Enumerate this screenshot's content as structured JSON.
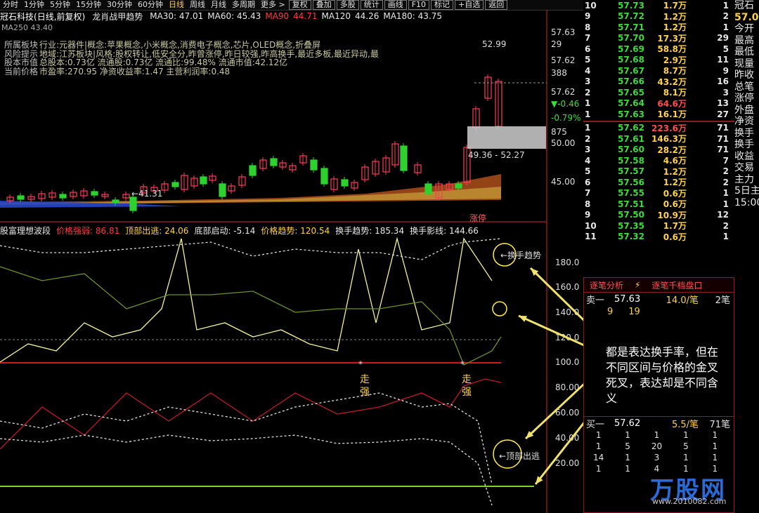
{
  "toolbar": {
    "items": [
      "分时",
      "1分钟",
      "5分钟",
      "15分钟",
      "30分钟",
      "60分钟",
      "日线",
      "周线",
      "月线",
      "多周期",
      "更多 >",
      "复权",
      "叠加",
      "多股",
      "统计",
      "画线",
      "F10",
      "标记",
      "+自选",
      "返回"
    ],
    "active": "日线"
  },
  "main_chart": {
    "stock_name": "冠石科技",
    "period_label": "(日线,前复权)",
    "indicator_name": "龙肖战甲趋势",
    "ma": [
      {
        "label": "MA30: 47.01",
        "color": "#e8e8e8"
      },
      {
        "label": "MA60: 45.43",
        "color": "#e8e8e8"
      },
      {
        "label": "MA90",
        "color": "#ff3b3b"
      },
      {
        "label": "44.71",
        "color": "#ff3b3b"
      },
      {
        "label": "MA120",
        "color": "#e8e8e8"
      },
      {
        "label": "44.26",
        "color": "#e8e8e8"
      },
      {
        "label": "MA180: 43.75",
        "color": "#e8e8e8"
      }
    ],
    "ma250": "MA250  43.40",
    "f10": [
      {
        "label": "所属板块",
        "text": "行业:元器件|概念:苹果概念,小米概念,消费电子概念,芯片,OLED概念,折叠屏"
      },
      {
        "label": "风险提示",
        "text": "地域:江苏板块|风格:股权转让,低安全分,昨曾涨停,昨日较强,昨高换手,最近多板,最近异动,最"
      },
      {
        "label": "股本市值",
        "text": "总股本:0.73亿 流通股:0.73亿 流通比:99.48% 流通市值:42.12亿"
      },
      {
        "label": "当前价格",
        "text": "市盈率:270.95 净资收益率:1.47 主营利润率:0.48"
      }
    ],
    "annotations": {
      "high": "52.99",
      "low": "←41.31",
      "range": "49.36 - 52.27",
      "zhangting": "涨停"
    },
    "y_axis": [
      {
        "v": "57.63",
        "c": "w"
      },
      {
        "v": "29",
        "c": "w"
      },
      {
        "v": "57.62",
        "c": "w"
      },
      {
        "v": "388",
        "c": "w"
      },
      {
        "v": "57.62",
        "c": "w"
      },
      {
        "v": "▼-0.46",
        "c": "g"
      },
      {
        "v": "-0.79%",
        "c": "g"
      },
      {
        "v": "875",
        "c": "w"
      },
      {
        "v": "50.00",
        "c": "w"
      },
      {
        "v": "45.00",
        "c": "w"
      }
    ]
  },
  "indicator": {
    "name": "股富理想波段",
    "items": [
      {
        "label": "价格强弱: 86.81",
        "color": "#ff3b3b"
      },
      {
        "label": "顶部出逃: 24.06",
        "color": "#ffd24a"
      },
      {
        "label": "底部启动: -5.14",
        "color": "#e8e8e8"
      },
      {
        "label": "价格趋势: 120.54",
        "color": "#ffd24a"
      },
      {
        "label": "换手趋势: 185.34",
        "color": "#e8e8e8"
      },
      {
        "label": "换手影线: 144.66",
        "color": "#e8e8e8"
      }
    ],
    "y_axis": [
      "180.0",
      "160.0",
      "140.0",
      "120.0",
      "100.0",
      "80.00",
      "60.00",
      "40.00",
      "20.00"
    ],
    "labels": {
      "zouqiang": "走强",
      "huanshou": "←换手趋势",
      "dingbu": "←顶部出逃"
    }
  },
  "order_book": {
    "sell": [
      {
        "lv": "10",
        "pr": "57.73",
        "vol": "1.7万",
        "ct": "1"
      },
      {
        "lv": "9",
        "pr": "57.72",
        "vol": "1.2万",
        "ct": "2"
      },
      {
        "lv": "8",
        "pr": "57.71",
        "vol": "1.2万",
        "ct": "1"
      },
      {
        "lv": "7",
        "pr": "57.70",
        "vol": "17.3万",
        "ct": "29"
      },
      {
        "lv": "6",
        "pr": "57.69",
        "vol": "58.8万",
        "ct": "5"
      },
      {
        "lv": "5",
        "pr": "57.68",
        "vol": "2.9万",
        "ct": "11"
      },
      {
        "lv": "4",
        "pr": "57.67",
        "vol": "8.7万",
        "ct": "9"
      },
      {
        "lv": "3",
        "pr": "57.66",
        "vol": "43.2万",
        "ct": "16"
      },
      {
        "lv": "2",
        "pr": "57.65",
        "vol": "8.1万",
        "ct": "3"
      },
      {
        "lv": "1",
        "pr": "57.64",
        "vol": "64.6万",
        "ct": "13"
      },
      {
        "lv": "1",
        "pr": "57.63",
        "vol": "16.1万",
        "ct": "27"
      }
    ],
    "buy": [
      {
        "lv": "1",
        "pr": "57.62",
        "vol": "223.6万",
        "ct": "71"
      },
      {
        "lv": "2",
        "pr": "57.61",
        "vol": "146.3万",
        "ct": "71"
      },
      {
        "lv": "3",
        "pr": "57.60",
        "vol": "28.2万",
        "ct": "71"
      },
      {
        "lv": "4",
        "pr": "57.58",
        "vol": "4.6万",
        "ct": "7"
      },
      {
        "lv": "5",
        "pr": "57.57",
        "vol": "1.2万",
        "ct": "2"
      },
      {
        "lv": "6",
        "pr": "57.56",
        "vol": "1.2万",
        "ct": "2"
      },
      {
        "lv": "7",
        "pr": "57.55",
        "vol": "0.6万",
        "ct": "1"
      },
      {
        "lv": "8",
        "pr": "57.51",
        "vol": "0.6万",
        "ct": "1"
      },
      {
        "lv": "9",
        "pr": "57.50",
        "vol": "10.9万",
        "ct": "12"
      },
      {
        "lv": "10",
        "pr": "57.35",
        "vol": "1.7万",
        "ct": "2"
      },
      {
        "lv": "11",
        "pr": "57.32",
        "vol": "0.6万",
        "ct": "1"
      }
    ]
  },
  "far_right": [
    "冠石",
    "57.0",
    "今开",
    "最高",
    "最低",
    "现量",
    "昨收",
    "总笔",
    "涨停",
    "外盘",
    "净资",
    "换手",
    "换手",
    "收益",
    "交易",
    "主力",
    "5日主",
    "15:00"
  ],
  "tick_panel": {
    "tabs": [
      "逐笔分析",
      "⚡",
      "逐笔千档盘口"
    ],
    "sell1": {
      "label": "卖一",
      "price": "57.63",
      "vol": "14.0/笔",
      "count": "2笔"
    },
    "sell1_detail": [
      "9",
      "19"
    ],
    "buy1": {
      "label": "买一",
      "price": "57.62",
      "vol": "5.5/笔",
      "count": "71笔"
    },
    "buy1_grid": [
      "1",
      "1",
      "1",
      "1",
      "1",
      "1",
      "5",
      "20",
      "5",
      "1",
      "14",
      "1",
      "3",
      "1",
      "1",
      "1",
      "1",
      "4",
      "1",
      "1"
    ]
  },
  "annotation": "都是表达换手率，但在不同区间与价格的金叉死叉，表达却是不同含义",
  "logo": {
    "name": "万股网",
    "url": "www.2010082.com"
  }
}
